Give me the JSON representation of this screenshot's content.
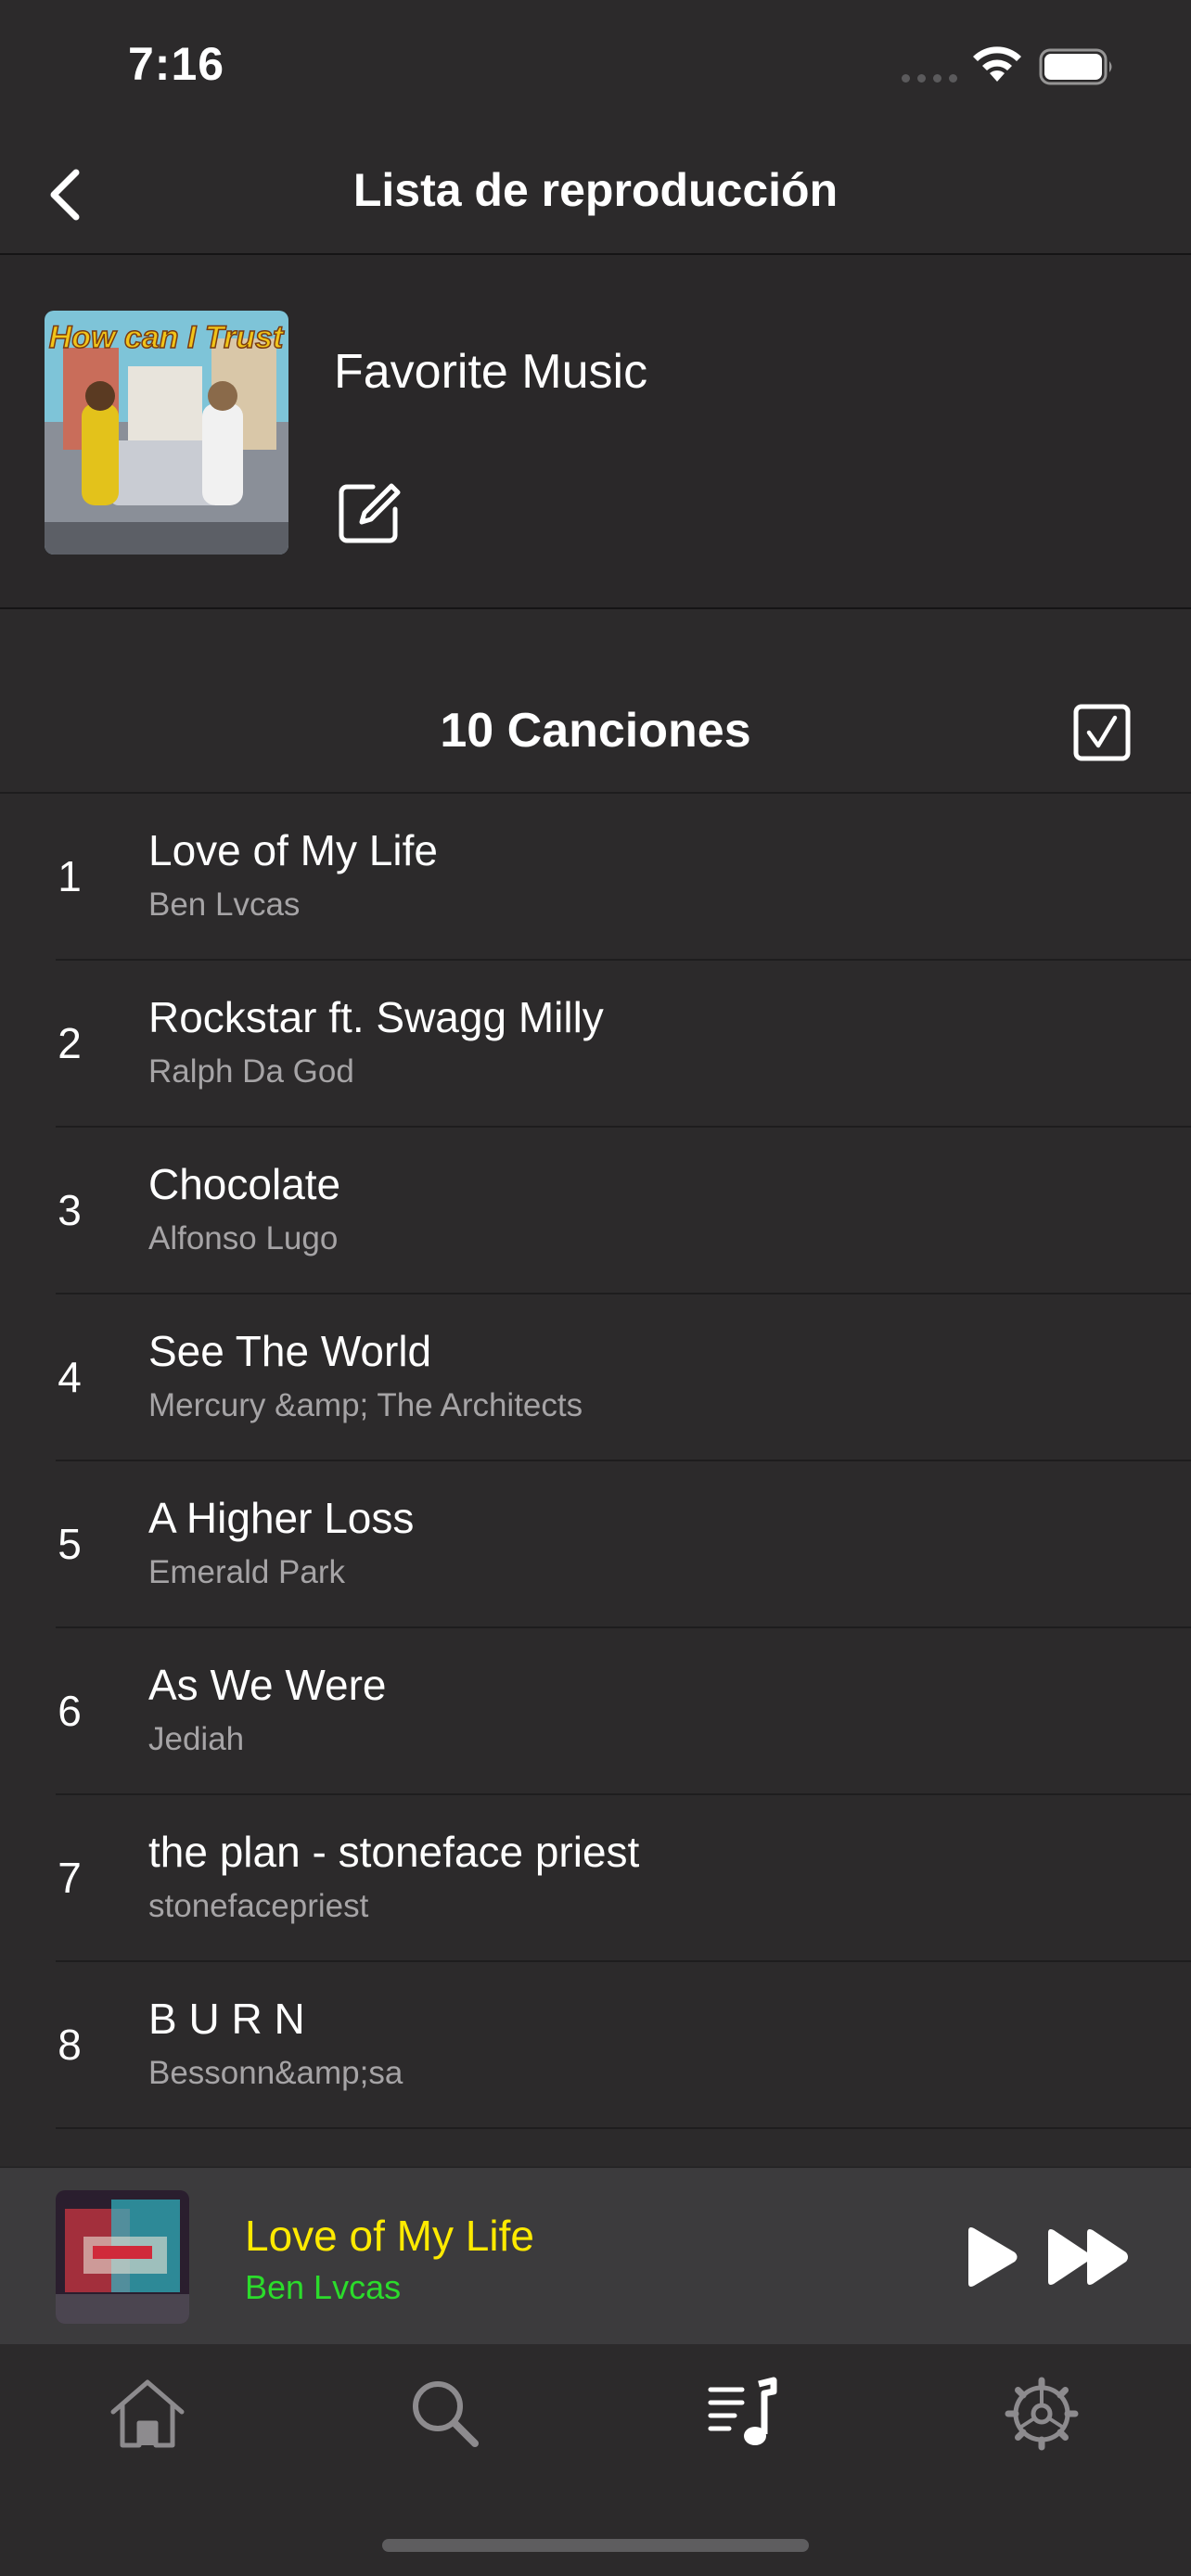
{
  "status_bar": {
    "time": "7:16",
    "icons": [
      "cellular-dots-icon",
      "wifi-icon",
      "battery-icon"
    ]
  },
  "nav": {
    "back_icon": "chevron-left-icon",
    "title": "Lista de reproducción"
  },
  "playlist": {
    "name": "Favorite Music",
    "cover_icon": "album-cover-art",
    "edit_icon": "edit-icon"
  },
  "songs_header": {
    "count_label": "10 Canciones",
    "select_icon": "checkbox-checked-icon"
  },
  "songs": [
    {
      "index": "1",
      "title": "Love of My Life",
      "artist": "Ben Lvcas"
    },
    {
      "index": "2",
      "title": "Rockstar ft. Swagg Milly",
      "artist": "Ralph Da God"
    },
    {
      "index": "3",
      "title": "Chocolate",
      "artist": "Alfonso Lugo"
    },
    {
      "index": "4",
      "title": "See The World",
      "artist": "Mercury &amp; The Architects"
    },
    {
      "index": "5",
      "title": "A Higher Loss",
      "artist": "Emerald Park"
    },
    {
      "index": "6",
      "title": "As We Were",
      "artist": "Jediah"
    },
    {
      "index": "7",
      "title": "the plan - stoneface priest",
      "artist": "stonefacepriest"
    },
    {
      "index": "8",
      "title": "B U R N",
      "artist": "Bessonn&amp;sa"
    }
  ],
  "now_playing": {
    "title": "Love of My Life",
    "artist": "Ben Lvcas",
    "play_icon": "play-icon",
    "next_icon": "fast-forward-icon"
  },
  "tab_bar": {
    "tabs": [
      "home-icon",
      "search-icon",
      "playlist-icon",
      "settings-icon"
    ],
    "active_tab": "playlist-icon"
  },
  "colors": {
    "background": "#2c2a2b",
    "now_playing_title": "#ffea00",
    "now_playing_artist": "#2bdc2b",
    "secondary_text": "#a6a4a6"
  }
}
